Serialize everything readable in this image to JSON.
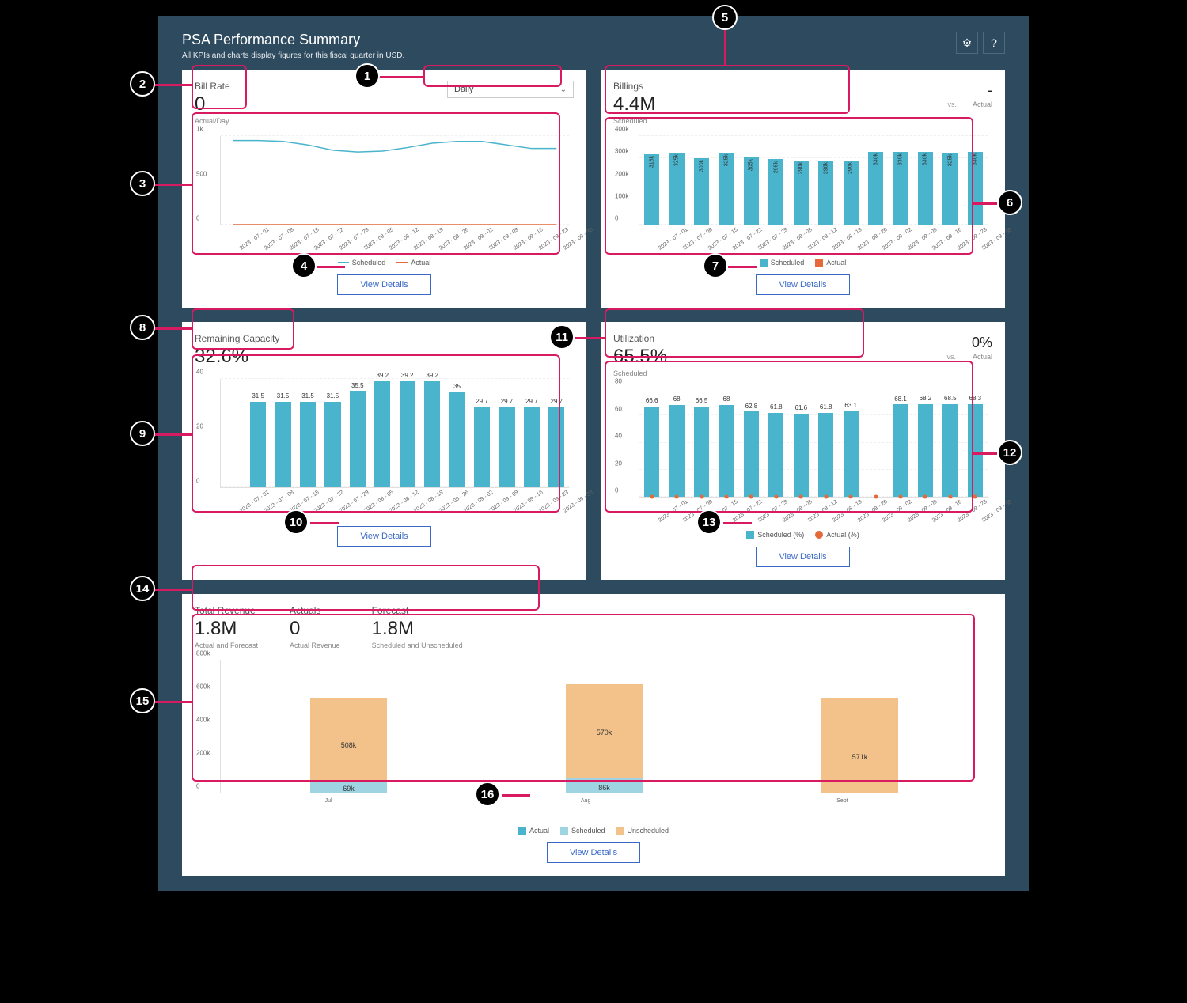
{
  "header": {
    "title": "PSA Performance Summary",
    "subtitle": "All KPIs and charts display figures for this fiscal quarter in USD.",
    "gear_aria": "Settings",
    "help_aria": "Help"
  },
  "common": {
    "view_details": "View Details",
    "vs": "vs.",
    "dates": [
      "2023 - 07 - 01",
      "2023 - 07 - 08",
      "2023 - 07 - 15",
      "2023 - 07 - 22",
      "2023 - 07 - 29",
      "2023 - 08 - 05",
      "2023 - 08 - 12",
      "2023 - 08 - 19",
      "2023 - 08 - 26",
      "2023 - 09 - 02",
      "2023 - 09 - 09",
      "2023 - 09 - 16",
      "2023 - 09 - 23",
      "2023 - 09 - 30"
    ]
  },
  "bill_rate": {
    "label": "Bill Rate",
    "value": "0",
    "sub": "Actual/Day",
    "select_value": "Daily",
    "legend_scheduled": "Scheduled",
    "legend_actual": "Actual"
  },
  "billings": {
    "label": "Billings",
    "value": "4.4M",
    "sub": "Scheduled",
    "actual_value": "-",
    "actual_sub": "Actual",
    "legend_scheduled": "Scheduled",
    "legend_actual": "Actual"
  },
  "remaining_capacity": {
    "label": "Remaining Capacity",
    "value": "32.6%"
  },
  "utilization": {
    "label": "Utilization",
    "value": "65.5%",
    "sub": "Scheduled",
    "actual_value": "0%",
    "actual_sub": "Actual",
    "legend_scheduled": "Scheduled (%)",
    "legend_actual": "Actual (%)"
  },
  "revenue": {
    "label": "Total Revenue",
    "value": "1.8M",
    "sub": "Actual and Forecast",
    "actuals_label": "Actuals",
    "actuals_value": "0",
    "actuals_sub": "Actual Revenue",
    "forecast_label": "Forecast",
    "forecast_value": "1.8M",
    "forecast_sub": "Scheduled and Unscheduled",
    "legend_actual": "Actual",
    "legend_scheduled": "Scheduled",
    "legend_unscheduled": "Unscheduled"
  },
  "chart_data": [
    {
      "id": "bill_rate_chart",
      "type": "line",
      "x": [
        "2023-07-01",
        "2023-07-08",
        "2023-07-15",
        "2023-07-22",
        "2023-07-29",
        "2023-08-05",
        "2023-08-12",
        "2023-08-19",
        "2023-08-26",
        "2023-09-02",
        "2023-09-09",
        "2023-09-16",
        "2023-09-23",
        "2023-09-30"
      ],
      "series": [
        {
          "name": "Scheduled",
          "color": "#4ab4cc",
          "values": [
            950,
            950,
            940,
            900,
            840,
            820,
            830,
            870,
            920,
            940,
            940,
            900,
            860,
            860
          ]
        },
        {
          "name": "Actual",
          "color": "#e46a3a",
          "values": [
            0,
            0,
            0,
            0,
            0,
            0,
            0,
            0,
            0,
            0,
            0,
            0,
            0,
            0
          ]
        }
      ],
      "yticks": [
        0,
        500,
        "1k"
      ],
      "ylim": [
        0,
        1000
      ]
    },
    {
      "id": "billings_chart",
      "type": "bar",
      "x": [
        "2023-07-01",
        "2023-07-08",
        "2023-07-15",
        "2023-07-22",
        "2023-07-29",
        "2023-08-05",
        "2023-08-12",
        "2023-08-19",
        "2023-08-26",
        "2023-09-02",
        "2023-09-09",
        "2023-09-16",
        "2023-09-23",
        "2023-09-30"
      ],
      "series": [
        {
          "name": "Scheduled",
          "color": "#4ab4cc",
          "values": [
            318000,
            325000,
            300000,
            325000,
            305000,
            295000,
            290000,
            290000,
            290000,
            330000,
            330000,
            330000,
            325000,
            330000
          ],
          "labels": [
            "318k",
            "325k",
            "300k",
            "325k",
            "305k",
            "295k",
            "290k",
            "290k",
            "290k",
            "330k",
            "330k",
            "330k",
            "325k",
            "330k"
          ]
        },
        {
          "name": "Actual",
          "color": "#e46a3a",
          "values": [
            0,
            0,
            0,
            0,
            0,
            0,
            0,
            0,
            0,
            0,
            0,
            0,
            0,
            0
          ]
        }
      ],
      "yticks": [
        0,
        "100k",
        "200k",
        "300k",
        "400k"
      ],
      "ylim": [
        0,
        400000
      ]
    },
    {
      "id": "remaining_capacity_chart",
      "type": "bar",
      "x": [
        "2023-07-01",
        "2023-07-08",
        "2023-07-15",
        "2023-07-22",
        "2023-07-29",
        "2023-08-05",
        "2023-08-12",
        "2023-08-19",
        "2023-08-26",
        "2023-09-02",
        "2023-09-09",
        "2023-09-16",
        "2023-09-23",
        "2023-09-30"
      ],
      "series": [
        {
          "name": "Remaining Capacity (%)",
          "color": "#4ab4cc",
          "values": [
            null,
            31.5,
            31.5,
            31.5,
            31.5,
            35.5,
            39.2,
            39.2,
            39.2,
            35,
            29.7,
            29.7,
            29.7,
            29.7
          ]
        }
      ],
      "yticks": [
        0,
        20,
        40
      ],
      "ylim": [
        0,
        40
      ]
    },
    {
      "id": "utilization_chart",
      "type": "bar_line",
      "x": [
        "2023-07-01",
        "2023-07-08",
        "2023-07-15",
        "2023-07-22",
        "2023-07-29",
        "2023-08-05",
        "2023-08-12",
        "2023-08-19",
        "2023-08-26",
        "2023-09-02",
        "2023-09-09",
        "2023-09-16",
        "2023-09-23",
        "2023-09-30"
      ],
      "series": [
        {
          "name": "Scheduled (%)",
          "color": "#4ab4cc",
          "values": [
            66.6,
            68.0,
            66.5,
            68.0,
            62.8,
            61.8,
            61.6,
            61.8,
            63.1,
            null,
            68.1,
            68.2,
            68.5,
            68.3
          ]
        },
        {
          "name": "Actual (%)",
          "color": "#e46a3a",
          "style": "line",
          "values": [
            0,
            0,
            0,
            0,
            0,
            0,
            0,
            0,
            0,
            0,
            0,
            0,
            0,
            0
          ]
        }
      ],
      "yticks": [
        0,
        20,
        40,
        60,
        80
      ],
      "ylim": [
        0,
        80
      ]
    },
    {
      "id": "revenue_chart",
      "type": "stacked_bar",
      "categories": [
        "Jul",
        "Aug",
        "Sept"
      ],
      "series": [
        {
          "name": "Actual",
          "color": "#4ab4cc",
          "values": [
            0,
            0,
            0
          ]
        },
        {
          "name": "Scheduled",
          "color": "#9fd4e3",
          "values": [
            69000,
            86000,
            0
          ],
          "labels": [
            "69k",
            "86k",
            ""
          ]
        },
        {
          "name": "Unscheduled",
          "color": "#f2c28a",
          "values": [
            508000,
            570000,
            571000
          ],
          "labels": [
            "508k",
            "570k",
            "571k"
          ]
        }
      ],
      "yticks": [
        0,
        "200k",
        "400k",
        "600k",
        "800k"
      ],
      "ylim": [
        0,
        800000
      ]
    }
  ]
}
